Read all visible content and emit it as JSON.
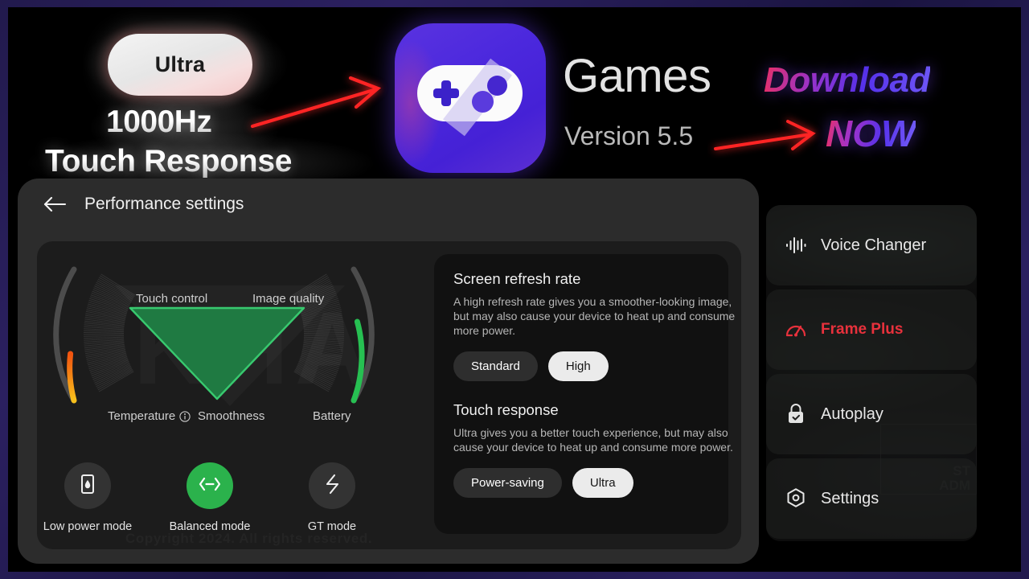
{
  "banner": {
    "ultra_pill_label": "Ultra",
    "hz_text": "1000Hz",
    "touch_text": "Touch Response",
    "app_title": "Games",
    "version": "Version 5.5",
    "download_text": "Download",
    "now_text": "NOW",
    "app_icon_name": "game-controller-icon"
  },
  "panel": {
    "title": "Performance settings",
    "back_icon": "back-arrow-icon",
    "watermark_big": "KHA",
    "watermark_small": "Copyright 2024. All rights reserved.",
    "gauge": {
      "top_left_label": "Touch control",
      "top_right_label": "Image quality",
      "bottom_left_label": "Temperature",
      "bottom_center_label": "Smoothness",
      "bottom_right_label": "Battery",
      "info_icon": "info-icon",
      "temperature_arc_color": "#f5a524",
      "battery_arc_color": "#27c052",
      "track_color": "#4a4a4a",
      "triangle_color": "#1f7a42",
      "triangle_stroke": "#35c26a",
      "temperature_fill_pct": 32,
      "battery_fill_pct": 62
    },
    "modes": [
      {
        "label": "Low power mode",
        "icon": "battery-drop-icon",
        "active": false
      },
      {
        "label": "Balanced mode",
        "icon": "balance-arrows-icon",
        "active": true
      },
      {
        "label": "GT mode",
        "icon": "lightning-bolt-icon",
        "active": false
      }
    ]
  },
  "settings_card": {
    "refresh": {
      "title": "Screen refresh rate",
      "description": "A high refresh rate gives you a smoother-looking image, but may also cause your device to heat up and consume more power.",
      "options": [
        {
          "label": "Standard",
          "selected": false
        },
        {
          "label": "High",
          "selected": true
        }
      ]
    },
    "touch": {
      "title": "Touch response",
      "description": "Ultra gives you a better touch experience, but may also cause your device to heat up and consume more power.",
      "options": [
        {
          "label": "Power-saving",
          "selected": false
        },
        {
          "label": "Ultra",
          "selected": true
        }
      ]
    }
  },
  "sidebar": {
    "items": [
      {
        "label": "Voice Changer",
        "icon": "waveform-icon",
        "highlight": false
      },
      {
        "label": "Frame Plus",
        "icon": "speedometer-icon",
        "highlight": true
      },
      {
        "label": "Autoplay",
        "icon": "lock-check-icon",
        "highlight": false
      },
      {
        "label": "Settings",
        "icon": "hexagon-gear-icon",
        "highlight": false
      }
    ],
    "watermark_line1": "ST",
    "watermark_line2": "ADM"
  },
  "colors": {
    "frame_border": "#241c52",
    "accent_purple": "#4b28dd",
    "accent_red": "#e8313c",
    "accent_green": "#2bb24c",
    "arrow_red": "#ff2020"
  }
}
